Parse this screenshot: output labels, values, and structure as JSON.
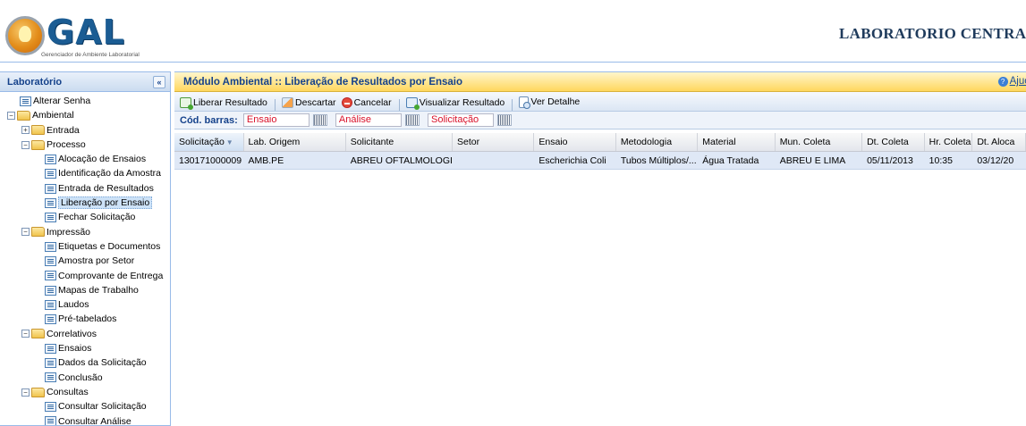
{
  "header": {
    "logo_text": "GAL",
    "logo_subtitle": "Gerenciador de Ambiente Laboratorial",
    "lab_title": "LABORATORIO CENTRA"
  },
  "sidebar": {
    "title": "Laboratório",
    "collapse_icon": "«",
    "tree": [
      {
        "label": "Alterar Senha",
        "level": 1,
        "type": "leaf"
      },
      {
        "label": "Ambiental",
        "level": 0,
        "type": "folder",
        "toggle": "−"
      },
      {
        "label": "Entrada",
        "level": 1,
        "type": "folder",
        "toggle": "+"
      },
      {
        "label": "Processo",
        "level": 1,
        "type": "folder",
        "toggle": "−"
      },
      {
        "label": "Alocação de Ensaios",
        "level": 2,
        "type": "leaf"
      },
      {
        "label": "Identificação da Amostra",
        "level": 2,
        "type": "leaf"
      },
      {
        "label": "Entrada de Resultados",
        "level": 2,
        "type": "leaf"
      },
      {
        "label": "Liberação por Ensaio",
        "level": 2,
        "type": "leaf",
        "selected": true
      },
      {
        "label": "Fechar Solicitação",
        "level": 2,
        "type": "leaf"
      },
      {
        "label": "Impressão",
        "level": 1,
        "type": "folder",
        "toggle": "−"
      },
      {
        "label": "Etiquetas e Documentos",
        "level": 2,
        "type": "leaf"
      },
      {
        "label": "Amostra por Setor",
        "level": 2,
        "type": "leaf"
      },
      {
        "label": "Comprovante de Entrega",
        "level": 2,
        "type": "leaf"
      },
      {
        "label": "Mapas de Trabalho",
        "level": 2,
        "type": "leaf"
      },
      {
        "label": "Laudos",
        "level": 2,
        "type": "leaf"
      },
      {
        "label": "Pré-tabelados",
        "level": 2,
        "type": "leaf"
      },
      {
        "label": "Correlativos",
        "level": 1,
        "type": "folder",
        "toggle": "−"
      },
      {
        "label": "Ensaios",
        "level": 2,
        "type": "leaf"
      },
      {
        "label": "Dados da Solicitação",
        "level": 2,
        "type": "leaf"
      },
      {
        "label": "Conclusão",
        "level": 2,
        "type": "leaf"
      },
      {
        "label": "Consultas",
        "level": 1,
        "type": "folder",
        "toggle": "−"
      },
      {
        "label": "Consultar Solicitação",
        "level": 2,
        "type": "leaf"
      },
      {
        "label": "Consultar Análise",
        "level": 2,
        "type": "leaf"
      }
    ]
  },
  "panel": {
    "title": "Módulo Ambiental :: Liberação de Resultados por Ensaio",
    "help_label": "Ajuc"
  },
  "toolbar": {
    "liberar": "Liberar Resultado",
    "descartar": "Descartar",
    "cancelar": "Cancelar",
    "visualizar": "Visualizar Resultado",
    "detalhe": "Ver Detalhe"
  },
  "filters": {
    "label": "Cód. barras:",
    "ensaio": "Ensaio",
    "analise": "Análise",
    "solicitacao": "Solicitação"
  },
  "grid": {
    "columns": [
      "Solicitação",
      "Lab. Origem",
      "Solicitante",
      "Setor",
      "Ensaio",
      "Metodologia",
      "Material",
      "Mun. Coleta",
      "Dt. Coleta",
      "Hr. Coleta",
      "Dt. Aloca"
    ],
    "sorted_column": 0,
    "rows": [
      [
        "130171000009",
        "AMB.PE",
        "ABREU OFTALMOLOGIA",
        "",
        "Escherichia Coli",
        "Tubos Múltiplos/...",
        "Água Tratada",
        "ABREU E LIMA",
        "05/11/2013",
        "10:35",
        "03/12/20"
      ]
    ]
  }
}
